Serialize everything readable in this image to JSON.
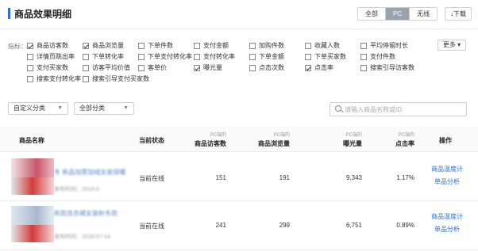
{
  "header": {
    "title": "商品效果明细",
    "segments": [
      {
        "label": "全部",
        "active": false
      },
      {
        "label": "PC",
        "active": true
      },
      {
        "label": "无线",
        "active": false
      }
    ],
    "download_label": "↓下载",
    "accent_color": "#2f6fd0"
  },
  "metrics": {
    "label": "指标：",
    "more_label": "更多 ▾",
    "items": [
      {
        "label": "商品访客数",
        "checked": true
      },
      {
        "label": "商品浏览量",
        "checked": true
      },
      {
        "label": "下单件数",
        "checked": false
      },
      {
        "label": "支付金额",
        "checked": false
      },
      {
        "label": "加购件数",
        "checked": false
      },
      {
        "label": "收藏人数",
        "checked": false
      },
      {
        "label": "平均停留时长",
        "checked": false
      },
      {
        "label": "详情页跳出率",
        "checked": false
      },
      {
        "label": "下单转化率",
        "checked": false
      },
      {
        "label": "下单支付转化率",
        "checked": false
      },
      {
        "label": "支付转化率",
        "checked": false
      },
      {
        "label": "下单金额",
        "checked": false
      },
      {
        "label": "下单买家数",
        "checked": false
      },
      {
        "label": "支付件数",
        "checked": false
      },
      {
        "label": "支付买家数",
        "checked": false
      },
      {
        "label": "访客平均价值",
        "checked": false
      },
      {
        "label": "客单价",
        "checked": false
      },
      {
        "label": "曝光量",
        "checked": true
      },
      {
        "label": "点击次数",
        "checked": false
      },
      {
        "label": "点击率",
        "checked": true
      },
      {
        "label": "搜索引导访客数",
        "checked": false
      },
      {
        "label": "搜索支付转化率",
        "checked": false
      },
      {
        "label": "搜索引导支付买家数",
        "checked": false
      }
    ]
  },
  "filters": {
    "custom_category": "自定义分类",
    "all_category": "全部分类",
    "search_placeholder": "请输入商品名称或ID"
  },
  "table": {
    "headers": {
      "name": "商品名称",
      "status": "当前状态",
      "visitors_sub": "PC端的",
      "visitors": "商品访客数",
      "views_sub": "PC端的",
      "views": "商品浏览量",
      "exposure_sub": "PC端的",
      "exposure": "曝光量",
      "ctr_sub": "PC端的",
      "ctr": "点击率",
      "action": "操作"
    },
    "rows": [
      {
        "name": "冬 新品加厚加绒女装保暖",
        "meta": "发布时间：2016-0",
        "status": "当前在线",
        "visitors": "151",
        "views": "191",
        "exposure": "9,343",
        "ctr": "1.17%",
        "action1": "商品温度计",
        "action2": "单品分析"
      },
      {
        "name": "新款连衣裙女装秋冬款",
        "meta": "发布时间：2016-07-14",
        "status": "当前在线",
        "visitors": "241",
        "views": "299",
        "exposure": "6,751",
        "ctr": "0.89%",
        "action1": "商品温度计",
        "action2": "单品分析"
      }
    ]
  }
}
